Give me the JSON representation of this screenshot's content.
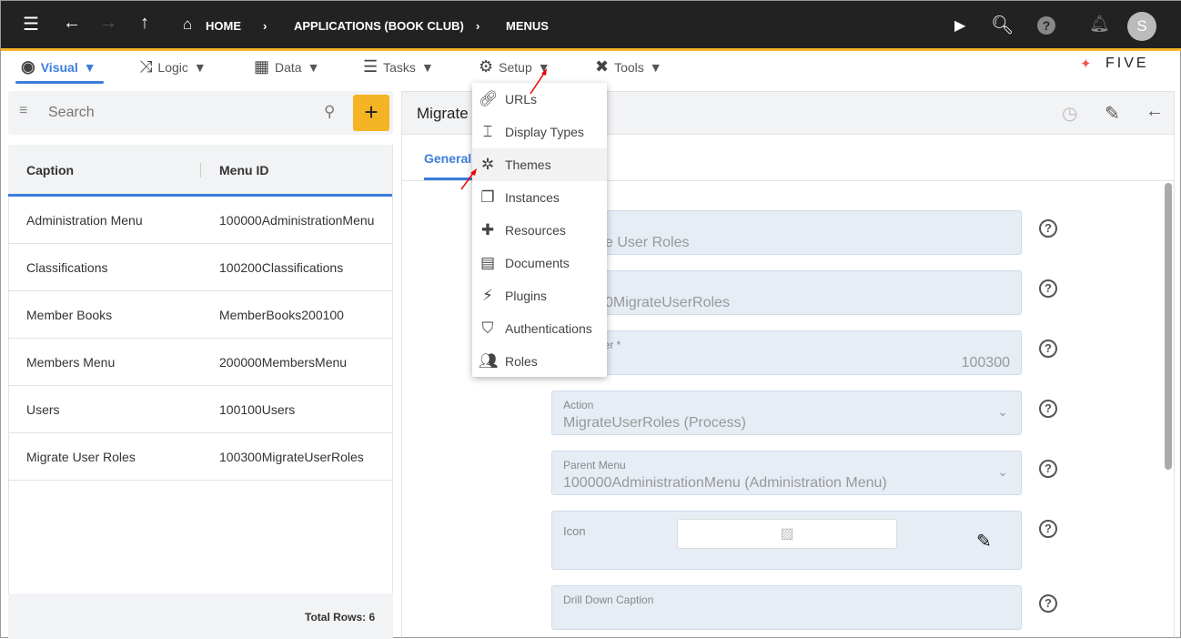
{
  "topbar": {
    "breadcrumbs": [
      "HOME",
      "APPLICATIONS (BOOK CLUB)",
      "MENUS"
    ],
    "avatar": "S"
  },
  "colors": {
    "accent": "#f5b423",
    "primary": "#3b7ddd",
    "topbar": "#222222"
  },
  "menubar": {
    "items": [
      {
        "label": "Visual",
        "icon": "eye-icon",
        "active": true
      },
      {
        "label": "Logic",
        "icon": "logic-icon"
      },
      {
        "label": "Data",
        "icon": "table-icon"
      },
      {
        "label": "Tasks",
        "icon": "checklist-icon"
      },
      {
        "label": "Setup",
        "icon": "gear-icon"
      },
      {
        "label": "Tools",
        "icon": "tools-icon"
      }
    ],
    "caret": "▼",
    "logo": "FIVE"
  },
  "setup_menu": [
    {
      "label": "URLs",
      "icon": "link-icon"
    },
    {
      "label": "Display Types",
      "icon": "display-type-icon"
    },
    {
      "label": "Themes",
      "icon": "theme-icon",
      "hovered": true
    },
    {
      "label": "Instances",
      "icon": "instances-icon"
    },
    {
      "label": "Resources",
      "icon": "puzzle-icon"
    },
    {
      "label": "Documents",
      "icon": "document-icon"
    },
    {
      "label": "Plugins",
      "icon": "plug-icon"
    },
    {
      "label": "Authentications",
      "icon": "shield-icon"
    },
    {
      "label": "Roles",
      "icon": "people-icon"
    }
  ],
  "list": {
    "search_placeholder": "Search",
    "columns": [
      "Caption",
      "Menu ID"
    ],
    "rows": [
      [
        "Administration Menu",
        "100000AdministrationMenu"
      ],
      [
        "Classifications",
        "100200Classifications"
      ],
      [
        "Member Books",
        "MemberBooks200100"
      ],
      [
        "Members Menu",
        "200000MembersMenu"
      ],
      [
        "Users",
        "100100Users"
      ],
      [
        "Migrate User Roles",
        "100300MigrateUserRoles"
      ]
    ],
    "footer": "Total Rows: 6"
  },
  "detail": {
    "title": "Migrate",
    "tab": "General",
    "fields": [
      {
        "label": "*",
        "value": "e User Roles"
      },
      {
        "label": "*",
        "value": "0MigrateUserRoles"
      },
      {
        "label": "der *",
        "value": "100300"
      },
      {
        "label": "Action",
        "value": "MigrateUserRoles (Process)"
      },
      {
        "label": "Parent Menu",
        "value": "100000AdministrationMenu (Administration Menu)"
      },
      {
        "label": "Icon",
        "value": ""
      },
      {
        "label": "Drill Down Caption",
        "value": ""
      }
    ]
  }
}
